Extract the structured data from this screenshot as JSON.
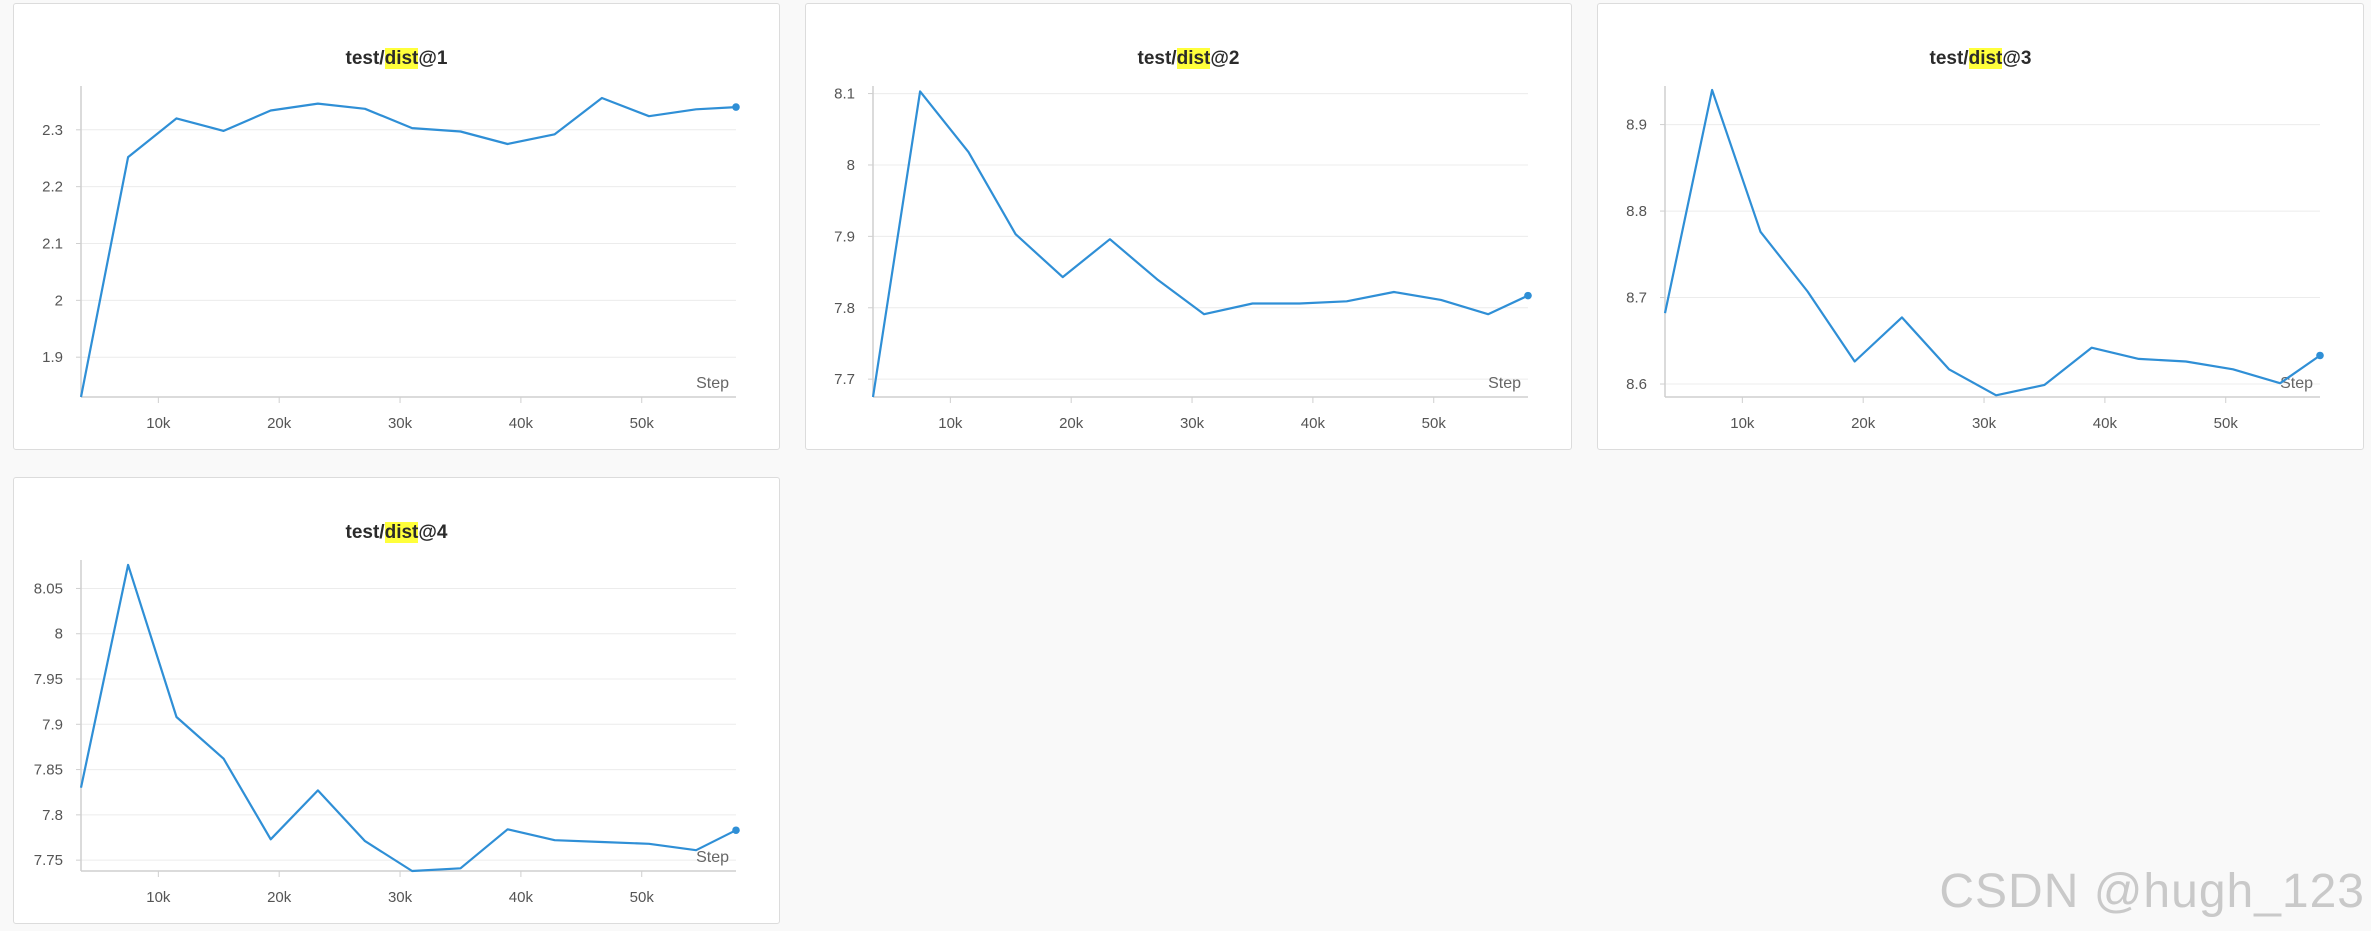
{
  "charts": [
    {
      "title": {
        "prefix": "test/",
        "highlight": "dist",
        "suffix": "@1"
      }
    },
    {
      "title": {
        "prefix": "test/",
        "highlight": "dist",
        "suffix": "@2"
      }
    },
    {
      "title": {
        "prefix": "test/",
        "highlight": "dist",
        "suffix": "@3"
      }
    },
    {
      "title": {
        "prefix": "test/",
        "highlight": "dist",
        "suffix": "@4"
      }
    }
  ],
  "highlight_color": "#ffff3b",
  "line_color": "#2f8fd6",
  "watermark": "CSDN @hugh_123",
  "chart_data": [
    {
      "type": "line",
      "title": "test/dist@1",
      "xlabel": "Step",
      "xlim": [
        3600,
        57800
      ],
      "ylim": [
        1.83,
        2.37
      ],
      "xticks": [
        10000,
        20000,
        30000,
        40000,
        50000
      ],
      "xtick_labels": [
        "10k",
        "20k",
        "30k",
        "40k",
        "50k"
      ],
      "yticks": [
        1.9,
        2.0,
        2.1,
        2.2,
        2.3
      ],
      "ytick_labels": [
        "1.9",
        "2",
        "2.1",
        "2.2",
        "2.3"
      ],
      "grid": true,
      "x": [
        3600,
        7500,
        11500,
        15400,
        19300,
        23200,
        27100,
        31000,
        35000,
        38900,
        42800,
        46700,
        50600,
        54500,
        57800
      ],
      "y": [
        1.83,
        2.252,
        2.32,
        2.298,
        2.334,
        2.346,
        2.337,
        2.303,
        2.297,
        2.275,
        2.292,
        2.356,
        2.324,
        2.336,
        2.34
      ]
    },
    {
      "type": "line",
      "title": "test/dist@2",
      "xlabel": "Step",
      "xlim": [
        3600,
        57800
      ],
      "ylim": [
        7.675,
        8.105
      ],
      "xticks": [
        10000,
        20000,
        30000,
        40000,
        50000
      ],
      "xtick_labels": [
        "10k",
        "20k",
        "30k",
        "40k",
        "50k"
      ],
      "yticks": [
        7.7,
        7.8,
        7.9,
        8.0,
        8.1
      ],
      "ytick_labels": [
        "7.7",
        "7.8",
        "7.9",
        "8",
        "8.1"
      ],
      "grid": true,
      "x": [
        3600,
        7500,
        11500,
        15400,
        19300,
        23200,
        27100,
        31000,
        35000,
        38900,
        42800,
        46700,
        50600,
        54500,
        57800
      ],
      "y": [
        7.675,
        8.103,
        8.018,
        7.903,
        7.843,
        7.896,
        7.84,
        7.791,
        7.806,
        7.806,
        7.809,
        7.822,
        7.811,
        7.791,
        7.817
      ]
    },
    {
      "type": "line",
      "title": "test/dist@3",
      "xlabel": "Step",
      "xlim": [
        3600,
        57800
      ],
      "ylim": [
        8.585,
        8.94
      ],
      "xticks": [
        10000,
        20000,
        30000,
        40000,
        50000
      ],
      "xtick_labels": [
        "10k",
        "20k",
        "30k",
        "40k",
        "50k"
      ],
      "yticks": [
        8.6,
        8.7,
        8.8,
        8.9
      ],
      "ytick_labels": [
        "8.6",
        "8.7",
        "8.8",
        "8.9"
      ],
      "grid": true,
      "x": [
        3600,
        7500,
        11500,
        15400,
        19300,
        23200,
        27100,
        31000,
        35000,
        38900,
        42800,
        46700,
        50600,
        54500,
        57800
      ],
      "y": [
        8.682,
        8.94,
        8.776,
        8.707,
        8.626,
        8.677,
        8.617,
        8.587,
        8.599,
        8.642,
        8.629,
        8.626,
        8.617,
        8.601,
        8.633
      ]
    },
    {
      "type": "line",
      "title": "test/dist@4",
      "xlabel": "Step",
      "xlim": [
        3600,
        57800
      ],
      "ylim": [
        7.738,
        8.077
      ],
      "xticks": [
        10000,
        20000,
        30000,
        40000,
        50000
      ],
      "xtick_labels": [
        "10k",
        "20k",
        "30k",
        "40k",
        "50k"
      ],
      "yticks": [
        7.75,
        7.8,
        7.85,
        7.9,
        7.95,
        8.0,
        8.05
      ],
      "ytick_labels": [
        "7.75",
        "7.8",
        "7.85",
        "7.9",
        "7.95",
        "8",
        "8.05"
      ],
      "grid": true,
      "x": [
        3600,
        7500,
        11500,
        15400,
        19300,
        23200,
        27100,
        31000,
        35000,
        38900,
        42800,
        46700,
        50600,
        54500,
        57800
      ],
      "y": [
        7.83,
        8.076,
        7.908,
        7.862,
        7.773,
        7.827,
        7.771,
        7.738,
        7.741,
        7.784,
        7.772,
        7.77,
        7.768,
        7.761,
        7.783
      ]
    }
  ]
}
